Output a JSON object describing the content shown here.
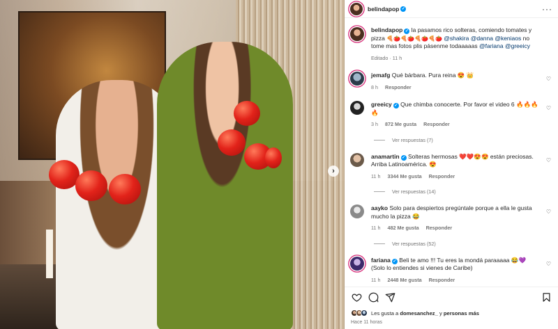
{
  "post": {
    "author": "belindapop",
    "caption": {
      "text_before": "la pasamos rico solteras, comiendo tomates y pizza ",
      "emojis": "🍕🍅🍕🍅🍕🍅🍕🍅",
      "mentions": [
        "@shakira",
        "@danna",
        "@keniaos"
      ],
      "text_after": " no tome mas fotos plis pásenme todaaaaas ",
      "mentions2": [
        "@fariana",
        "@greeicy"
      ],
      "meta": "Editado · 11 h"
    },
    "likes_text_prefix": "Les gusta a ",
    "likes_user": "domesanchez_",
    "likes_text_mid": " y ",
    "likes_others": "personas más",
    "time": "Hace 11 horas"
  },
  "comments": [
    {
      "user": "jemafg",
      "verified": false,
      "text": "Qué bárbara. Pura reina 😍 👑",
      "meta": {
        "time": "8 h",
        "likes": "",
        "reply": "Responder"
      }
    },
    {
      "user": "greeicy",
      "verified": true,
      "text": "Que chimba conocerte. Por favor el video 6 🔥🔥🔥🔥",
      "meta": {
        "time": "3 h",
        "likes": "872 Me gusta",
        "reply": "Responder"
      },
      "replies": "Ver respuestas (7)"
    },
    {
      "user": "anamartin",
      "verified": true,
      "text": "Solteras hermosas ❤️❤️😍😍 están preciosas. Arriba Latinoamérica. 😍",
      "meta": {
        "time": "11 h",
        "likes": "3344 Me gusta",
        "reply": "Responder"
      },
      "replies": "Ver respuestas (14)"
    },
    {
      "user": "aayko",
      "verified": false,
      "text": "Solo para despiertos pregúntale porque a ella le gusta mucho la pizza 😂",
      "meta": {
        "time": "11 h",
        "likes": "482 Me gusta",
        "reply": "Responder"
      },
      "replies": "Ver respuestas (52)"
    },
    {
      "user": "fariana",
      "verified": true,
      "text": "Beli te amo !!! Tu eres la mondá paraaaaa 😂💜 (Solo lo entiendes si vienes de Caribe)",
      "meta": {
        "time": "11 h",
        "likes": "2448 Me gusta",
        "reply": "Responder"
      }
    }
  ],
  "colors": {
    "verified": "#0095f6",
    "mention": "#00376b",
    "meta": "#737373",
    "story_ring": "#d62976"
  },
  "icons": [
    "more-icon",
    "heart-icon",
    "comment-icon",
    "share-icon",
    "bookmark-icon",
    "chevron-right-icon",
    "verified-icon"
  ]
}
